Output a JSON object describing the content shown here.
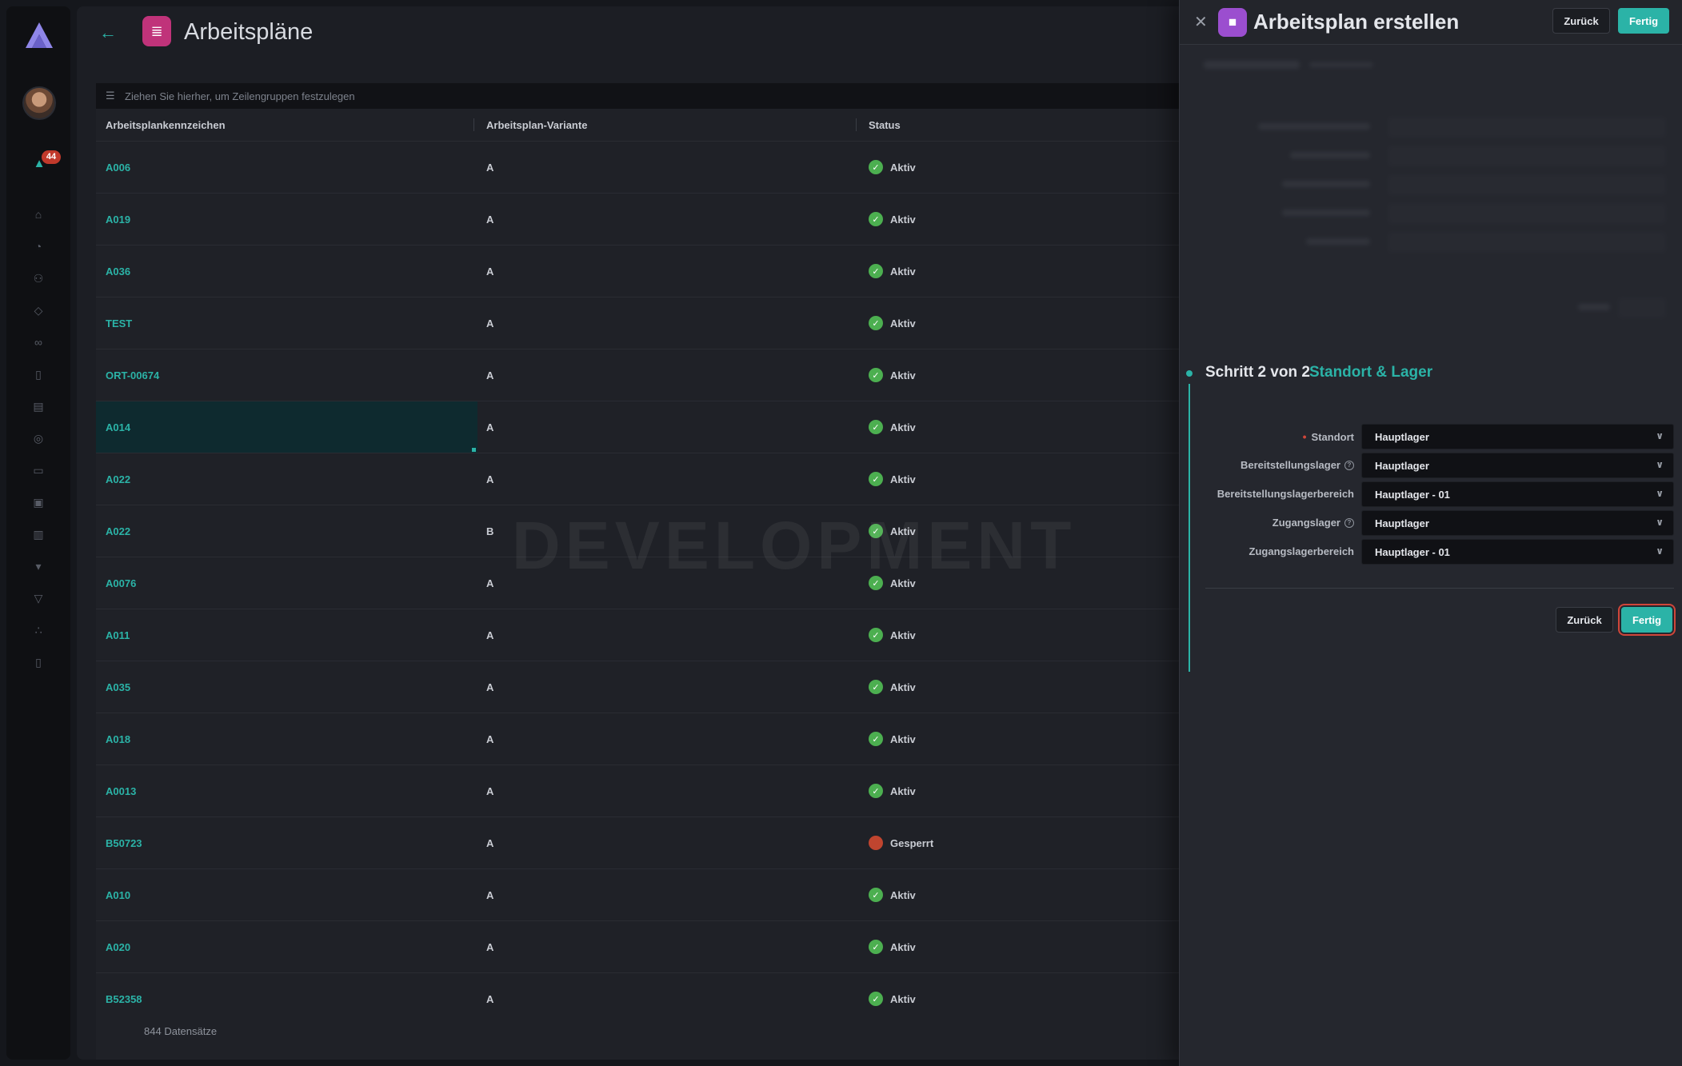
{
  "sidebar": {
    "notification_count": "44",
    "nav_icons": [
      "home-icon",
      "dashboard-icon",
      "users-icon",
      "tag-icon",
      "link-icon",
      "clipboard-icon",
      "warehouse-icon",
      "medal-icon",
      "folder-icon",
      "stack-icon",
      "database-icon",
      "location-icon",
      "shield-icon",
      "share-icon",
      "document-icon"
    ]
  },
  "main": {
    "title": "Arbeitspläne",
    "grouping_hint": "Ziehen Sie hierher, um Zeilengruppen festzulegen",
    "columns": [
      "Arbeitsplankennzeichen",
      "Arbeitsplan-Variante",
      "Status"
    ],
    "rows": [
      {
        "id": "A006",
        "variant": "A",
        "status": "Aktiv"
      },
      {
        "id": "A019",
        "variant": "A",
        "status": "Aktiv"
      },
      {
        "id": "A036",
        "variant": "A",
        "status": "Aktiv"
      },
      {
        "id": "TEST",
        "variant": "A",
        "status": "Aktiv"
      },
      {
        "id": "ORT-00674",
        "variant": "A",
        "status": "Aktiv"
      },
      {
        "id": "A014",
        "variant": "A",
        "status": "Aktiv"
      },
      {
        "id": "A022",
        "variant": "A",
        "status": "Aktiv"
      },
      {
        "id": "A022",
        "variant": "B",
        "status": "Aktiv"
      },
      {
        "id": "A0076",
        "variant": "A",
        "status": "Aktiv"
      },
      {
        "id": "A011",
        "variant": "A",
        "status": "Aktiv"
      },
      {
        "id": "A035",
        "variant": "A",
        "status": "Aktiv"
      },
      {
        "id": "A018",
        "variant": "A",
        "status": "Aktiv"
      },
      {
        "id": "A0013",
        "variant": "A",
        "status": "Aktiv"
      },
      {
        "id": "B50723",
        "variant": "A",
        "status": "Gesperrt"
      },
      {
        "id": "A010",
        "variant": "A",
        "status": "Aktiv"
      },
      {
        "id": "A020",
        "variant": "A",
        "status": "Aktiv"
      },
      {
        "id": "B52358",
        "variant": "A",
        "status": "Aktiv"
      }
    ],
    "selected_row": "A014",
    "watermark": "DEVELOPMENT",
    "record_count": "844",
    "record_label": "Datensätze"
  },
  "drawer": {
    "title": "Arbeitsplan erstellen",
    "back_label": "Zurück",
    "done_label": "Fertig",
    "step_title": "Schritt 2 von 2",
    "step_name": "Standort & Lager",
    "fields": [
      {
        "label": "Standort",
        "value": "Hauptlager",
        "required": true,
        "info": false
      },
      {
        "label": "Bereitstellungslager",
        "value": "Hauptlager",
        "required": false,
        "info": true
      },
      {
        "label": "Bereitstellungslagerbereich",
        "value": "Hauptlager - 01",
        "required": false,
        "info": false
      },
      {
        "label": "Zugangslager",
        "value": "Hauptlager",
        "required": false,
        "info": true
      },
      {
        "label": "Zugangslagerbereich",
        "value": "Hauptlager - 01",
        "required": false,
        "info": false
      }
    ]
  },
  "colors": {
    "accent": "#2bb3a7",
    "status_ok": "#4caf50",
    "status_locked": "#c0452f",
    "drawer_icon": "#9b4ecf",
    "page_icon": "#c0337a"
  }
}
